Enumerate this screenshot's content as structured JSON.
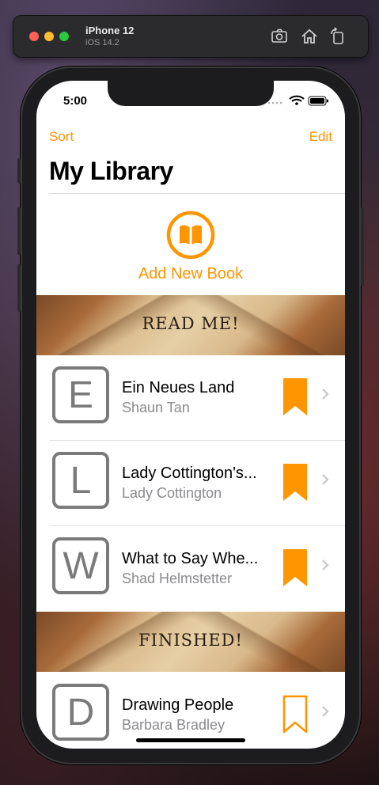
{
  "simulator": {
    "device_name": "iPhone 12",
    "os_version": "iOS 14.2"
  },
  "status_bar": {
    "time": "5:00"
  },
  "nav": {
    "sort_label": "Sort",
    "edit_label": "Edit",
    "title": "My Library"
  },
  "add_book": {
    "label": "Add New Book"
  },
  "sections": [
    {
      "header": "READ ME!",
      "books": [
        {
          "letter": "E",
          "title": "Ein Neues Land",
          "author": "Shaun Tan",
          "bookmark": "filled"
        },
        {
          "letter": "L",
          "title": "Lady Cottington's...",
          "author": "Lady Cottington",
          "bookmark": "filled"
        },
        {
          "letter": "W",
          "title": "What to Say Whe...",
          "author": "Shad Helmstetter",
          "bookmark": "filled"
        }
      ]
    },
    {
      "header": "FINISHED!",
      "books": [
        {
          "letter": "D",
          "title": "Drawing People",
          "author": "Barbara Bradley",
          "bookmark": "outline"
        }
      ]
    }
  ],
  "colors": {
    "accent": "#ff9500",
    "secondary_text": "#8a8a8e",
    "letter_tile": "#7a7a7a"
  },
  "icons": {
    "add_book": "book-circle-icon",
    "bookmark_filled": "bookmark-fill-icon",
    "bookmark_outline": "bookmark-outline-icon",
    "disclosure": "chevron-right-icon"
  }
}
